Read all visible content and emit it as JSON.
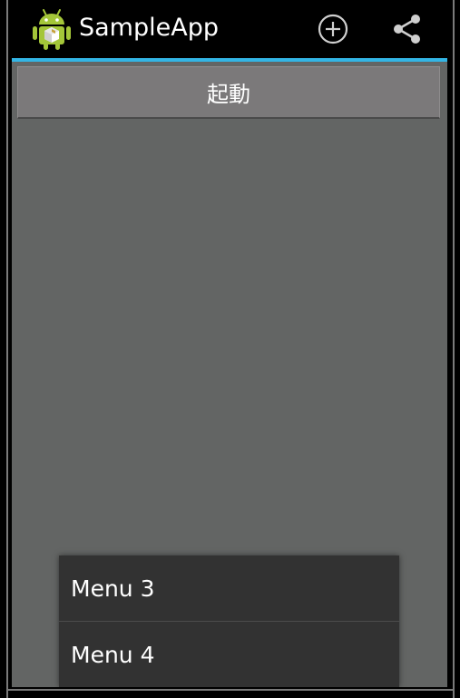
{
  "action_bar": {
    "app_icon": "android-robot-icon",
    "title": "SampleApp",
    "actions": [
      {
        "name": "add-icon"
      },
      {
        "name": "share-icon"
      }
    ]
  },
  "main": {
    "start_button_label": "起動"
  },
  "popup_menu": {
    "items": [
      {
        "label": "Menu 3"
      },
      {
        "label": "Menu 4"
      }
    ]
  },
  "colors": {
    "accent": "#33b5e5",
    "background": "#636564",
    "menu_background": "#323232",
    "android_green": "#a4c639"
  }
}
